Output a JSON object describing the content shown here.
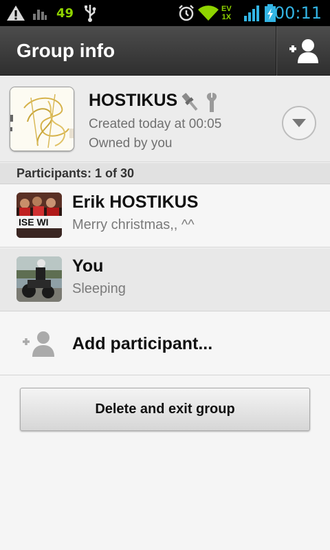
{
  "status_bar": {
    "network_number": "49",
    "carrier_top": "EV",
    "carrier_bottom": "1X",
    "time": "00:11"
  },
  "action_bar": {
    "title": "Group info",
    "add_participant_icon": "add-person-icon"
  },
  "group": {
    "name": "HOSTIKUS",
    "created": "Created today at 00:05",
    "owner": "Owned by you"
  },
  "participants": {
    "header": "Participants: 1 of 30",
    "items": [
      {
        "name": "Erik HOSTIKUS",
        "status": "Merry christmas,, ^^"
      },
      {
        "name": "You",
        "status": "Sleeping"
      }
    ],
    "add_label": "Add participant..."
  },
  "actions": {
    "delete_label": "Delete and exit group"
  },
  "colors": {
    "accent_blue": "#33b5e5",
    "status_green": "#8fd400"
  }
}
